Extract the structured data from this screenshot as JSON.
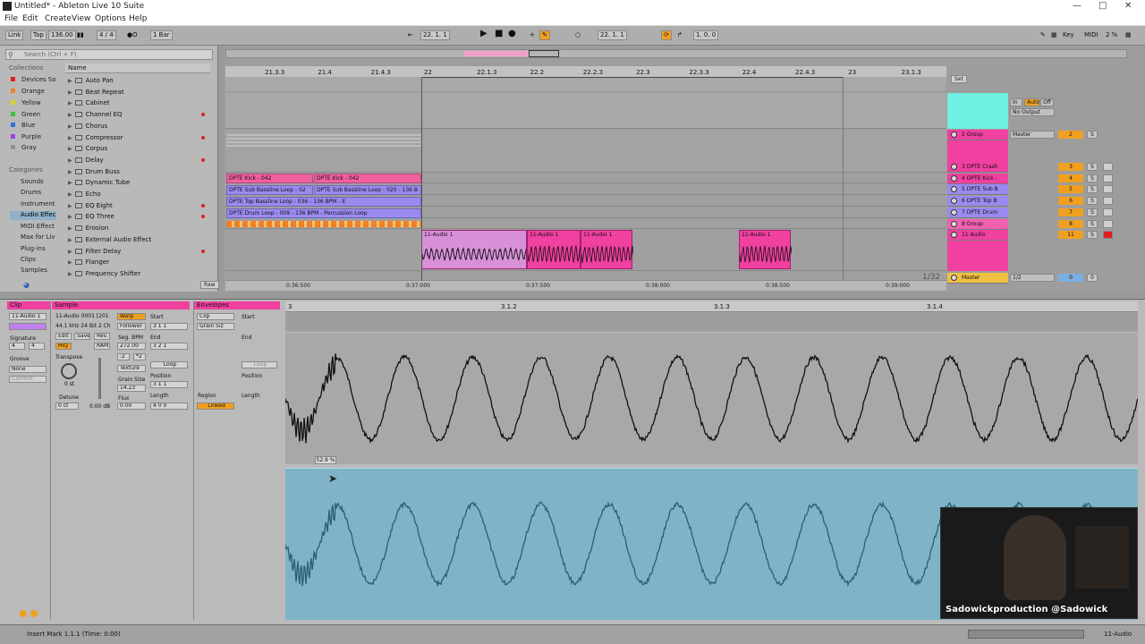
{
  "window": {
    "title": "Untitled* - Ableton Live 10 Suite"
  },
  "menu": [
    "File",
    "Edit",
    "Create",
    "View",
    "Options",
    "Help"
  ],
  "control_bar": {
    "link": "Link",
    "tap": "Tap",
    "tempo": "136.00",
    "signature": "4 / 4",
    "quantize": "1 Bar",
    "position": "22.   1.   1",
    "loop_start": "22.   1.   1",
    "loop_length": "1.   0.   0",
    "key": "Key",
    "midi": "MIDI",
    "cpu": "2 %"
  },
  "browser": {
    "search_placeholder": "Search (Ctrl + F)",
    "collections_label": "Collections",
    "collections": [
      {
        "name": "Devices So",
        "color": "#e02020"
      },
      {
        "name": "Orange",
        "color": "#f08020"
      },
      {
        "name": "Yellow",
        "color": "#e0d020"
      },
      {
        "name": "Green",
        "color": "#40c040"
      },
      {
        "name": "Blue",
        "color": "#3070e0"
      },
      {
        "name": "Purple",
        "color": "#a040e0"
      },
      {
        "name": "Gray",
        "color": "#909090"
      }
    ],
    "categories_label": "Categories",
    "categories": [
      "Sounds",
      "Drums",
      "Instrument",
      "Audio Effec",
      "MIDI Effect",
      "Max for Liv",
      "Plug-ins",
      "Clips",
      "Samples"
    ],
    "selected_category": "Audio Effec",
    "name_column": "Name",
    "items": [
      {
        "name": "Auto Pan",
        "dot": false
      },
      {
        "name": "Beat Repeat",
        "dot": false
      },
      {
        "name": "Cabinet",
        "dot": false
      },
      {
        "name": "Channel EQ",
        "dot": true
      },
      {
        "name": "Chorus",
        "dot": false
      },
      {
        "name": "Compressor",
        "dot": true
      },
      {
        "name": "Corpus",
        "dot": false
      },
      {
        "name": "Delay",
        "dot": true
      },
      {
        "name": "Drum Buss",
        "dot": false
      },
      {
        "name": "Dynamic Tube",
        "dot": false
      },
      {
        "name": "Echo",
        "dot": false
      },
      {
        "name": "EQ Eight",
        "dot": true
      },
      {
        "name": "EQ Three",
        "dot": true
      },
      {
        "name": "Erosion",
        "dot": false
      },
      {
        "name": "External Audio Effect",
        "dot": false
      },
      {
        "name": "Filter Delay",
        "dot": true
      },
      {
        "name": "Flanger",
        "dot": false
      },
      {
        "name": "Frequency Shifter",
        "dot": false
      }
    ],
    "raw": "Raw"
  },
  "arrangement": {
    "ruler_ticks": [
      "21.3.3",
      "21.4",
      "21.4.3",
      "22",
      "22.1.3",
      "22.2",
      "22.2.3",
      "22.3",
      "22.3.3",
      "22.4",
      "22.4.3",
      "23",
      "23.1.3"
    ],
    "set_label": "Set",
    "time_ticks": [
      "0:36:500",
      "0:37:000",
      "0:37:500",
      "0:38:000",
      "0:38:500",
      "0:39:000"
    ],
    "zoom": "1/32",
    "midi_clips": [
      {
        "label": "DPTE Kick - 042",
        "color": "#f060a0"
      },
      {
        "label": "DPTE Kick - 042",
        "color": "#f060a0"
      },
      {
        "label": "DPTE Sub Bassline Loop - 02",
        "color": "#9a8af0"
      },
      {
        "label": "DPTE Sub Bassline Loop - 020 - 136 B",
        "color": "#9a8af0"
      },
      {
        "label": "DPTE Top Bassline Loop - 036 - 136 BPM - E",
        "color": "#9a8af0"
      },
      {
        "label": "DPTE Drum Loop - 009 - 136 BPM - Percussion Loop",
        "color": "#9a8af0"
      }
    ],
    "audio_clips": [
      "11-Audio 1",
      "11-Audio 1",
      "11-Audio 1",
      "11-Audio 1"
    ],
    "tracks": [
      {
        "name": "2 Group",
        "color": "#f040a0",
        "io": "Master",
        "num": "2",
        "s": "S"
      },
      {
        "name": "3 DPTE Crash",
        "color": "#f040a0",
        "num": "3",
        "s": "S"
      },
      {
        "name": "4 DPTE Kick -",
        "color": "#f040a0",
        "num": "4",
        "s": "S"
      },
      {
        "name": "5 DPTE Sub B",
        "color": "#9a8af0",
        "num": "5",
        "s": "S"
      },
      {
        "name": "6 DPTE Top B",
        "color": "#9a8af0",
        "num": "6",
        "s": "S"
      },
      {
        "name": "7 DPTE Drum",
        "color": "#9a8af0",
        "num": "7",
        "s": "S"
      },
      {
        "name": "8 Group",
        "color": "#f060b0",
        "num": "8",
        "s": "S"
      },
      {
        "name": "11 Audio",
        "color": "#f040a0",
        "num": "11",
        "s": "S"
      },
      {
        "name": "Master",
        "color": "#f0c040",
        "io": "1/2",
        "num": "0",
        "s": "0"
      }
    ],
    "io_in": "In",
    "io_auto": "Auto",
    "io_off": "Off",
    "no_output": "No Output"
  },
  "clip_view": {
    "clip_label": "Clip",
    "clip_name": "11-Audio 1",
    "signature_label": "Signature",
    "sig_num": "4",
    "sig_den": "4",
    "groove_label": "Groove",
    "groove_value": "None",
    "commit": "Commit",
    "sample_label": "Sample",
    "sample_name": "11-Audio 0001 [201",
    "sample_info": "44.1 kHz 24 Bit 2 Ch",
    "edit": "Edit",
    "save": "Save",
    "rev": "Rev.",
    "hiq": "HiQ",
    "ram": "RAM",
    "transpose_label": "Transpose",
    "transpose_value": "0 st",
    "detune_label": "Detune",
    "detune_value": "0 ct",
    "gain_value": "0.00 dB",
    "warp": "Warp",
    "follower": "Follower",
    "seg_bpm_label": "Seg. BPM",
    "seg_bpm": "272.00",
    "half": ":2",
    "double": "*2",
    "texture": "Texture",
    "grain_size_label": "Grain Size",
    "grain_size": "14.23",
    "flux_label": "Flux",
    "flux": "0.00",
    "start_label": "Start",
    "end_label": "End",
    "loop": "Loop",
    "position_label": "Position",
    "length_label": "Length",
    "start_value": "3   1   1",
    "end_value": "3   2   1",
    "position_value": "3   1   1",
    "length_value": "4   0   0",
    "envelopes_label": "Envelopes",
    "env_clip": "Clip",
    "env_grain": "Grain Siz",
    "region_label": "Region",
    "linked": "Linked",
    "env_start": "Start",
    "env_end": "End",
    "env_loop": "Loop",
    "env_position": "Position",
    "env_length": "Length",
    "ruler": [
      "3",
      "3.1.2",
      "3.1.3",
      "3.1.4"
    ],
    "envelope_value": "52.9 %"
  },
  "webcam": {
    "handles": "Sadowickproduction  @Sadowick"
  },
  "status": {
    "message": "Insert Mark 1.1.1 (Time: 0:00)",
    "track": "11-Audio"
  },
  "colors": {
    "accent": "#f0a020",
    "clip_pink": "#f040a0",
    "clip_purple": "#9a8af0",
    "wave_blue": "#7fb3c8"
  }
}
